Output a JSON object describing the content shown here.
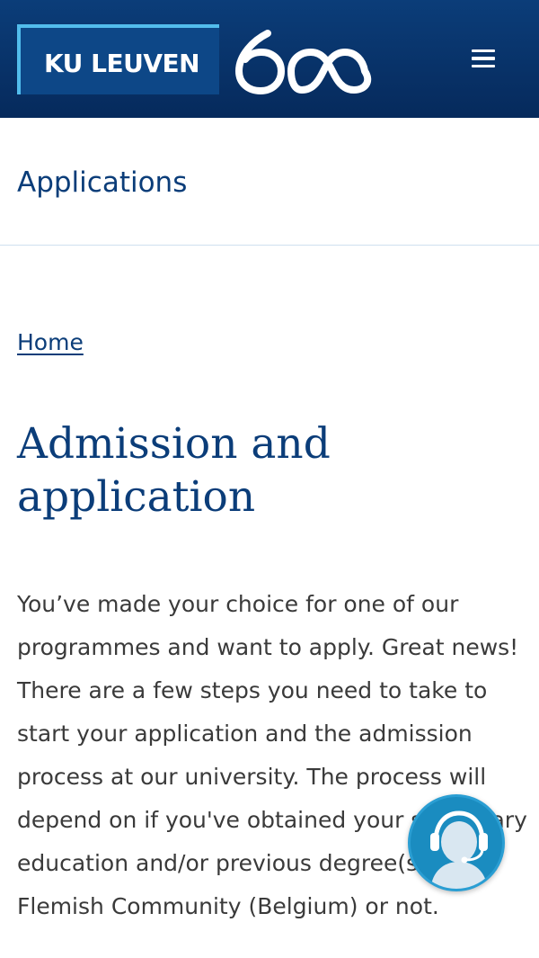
{
  "header": {
    "logo_text": "KU LEUVEN",
    "anniversary_logo": "600",
    "menu_icon": "hamburger-menu-icon"
  },
  "subnav": {
    "title": "Applications"
  },
  "breadcrumb": {
    "home": "Home"
  },
  "main": {
    "title_line1": "Admission and",
    "title_line2": "application",
    "intro": "You’ve made your choice for one of our programmes and want to apply. Great news! There are a few steps you need to take to start your application and the admission process at our university. The process will depend on if you've obtained your secondary education and/or previous degree(s) in the Flemish Community (Belgium) or not."
  },
  "chat": {
    "icon": "support-agent-icon"
  },
  "colors": {
    "header_bg": "#0b3d79",
    "brand_accent": "#52bdec",
    "title_text": "#0b3d79",
    "body_text": "#3a3a3a",
    "chat_bg": "#1a8cc0"
  }
}
